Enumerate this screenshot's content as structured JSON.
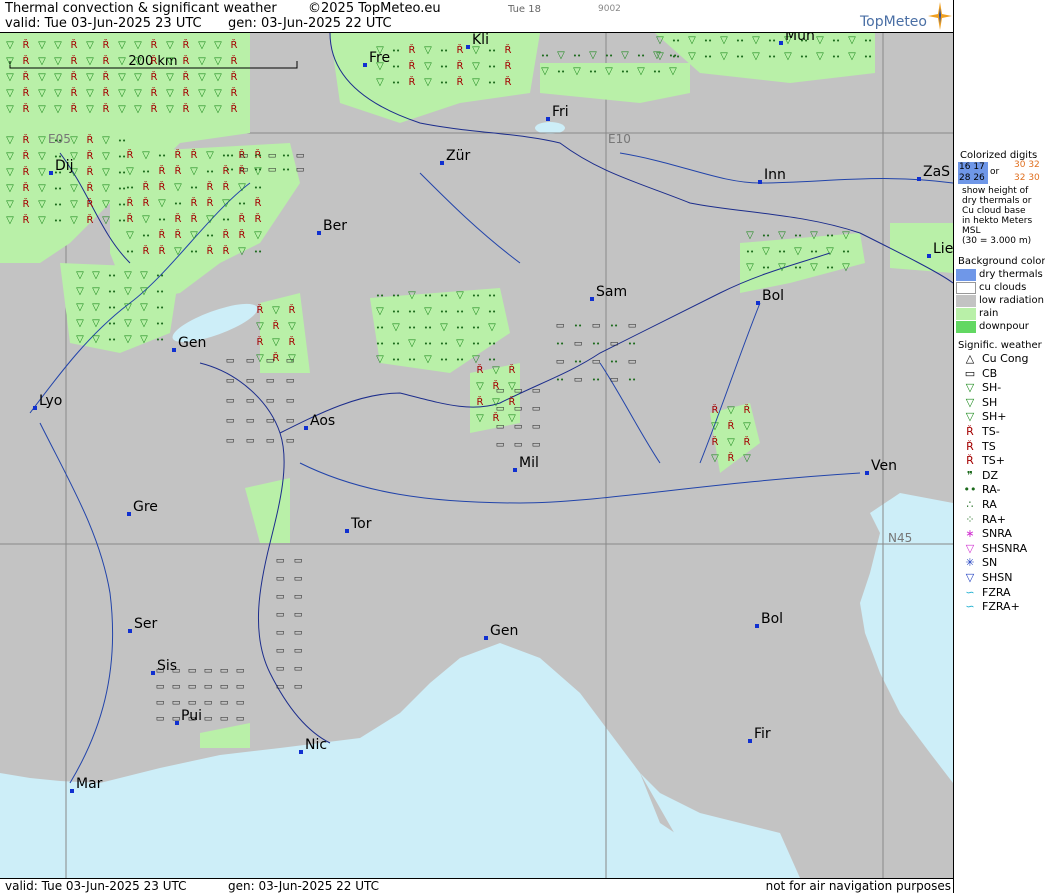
{
  "header": {
    "title": "Thermal convection & significant weather",
    "copyright": "©2025 TopMeteo.eu",
    "valid": "valid:  Tue  03-Jun-2025  23 UTC",
    "gen": "gen: 03-Jun-2025 22 UTC",
    "day_label": "Tue 18",
    "code": "9002",
    "logo": "TopMeteo"
  },
  "footer": {
    "valid": "valid:  Tue  03-Jun-2025  23 UTC",
    "gen": "gen: 03-Jun-2025 22 UTC",
    "note": "not for air navigation purposes"
  },
  "map": {
    "scale_label": "200 km",
    "grid_labels": [
      "E05",
      "E10",
      "N45"
    ],
    "cities": [
      {
        "name": "Kli"
      },
      {
        "name": "Mün"
      },
      {
        "name": "Fre"
      },
      {
        "name": "Fri"
      },
      {
        "name": "Dij"
      },
      {
        "name": "Zür"
      },
      {
        "name": "Inn"
      },
      {
        "name": "ZaS"
      },
      {
        "name": "Ber"
      },
      {
        "name": "Lie"
      },
      {
        "name": "Sam"
      },
      {
        "name": "Bol"
      },
      {
        "name": "Gen"
      },
      {
        "name": "Lyo"
      },
      {
        "name": "Aos"
      },
      {
        "name": "Mil"
      },
      {
        "name": "Ven"
      },
      {
        "name": "Gre"
      },
      {
        "name": "Tor"
      },
      {
        "name": "Ser"
      },
      {
        "name": "Gen"
      },
      {
        "name": "Bol"
      },
      {
        "name": "Sis"
      },
      {
        "name": "Pui"
      },
      {
        "name": "Nic"
      },
      {
        "name": "Fir"
      },
      {
        "name": "Mar"
      }
    ],
    "colors": {
      "land": "#c3c3c3",
      "sea": "#cdeef8",
      "rain": "#b9f0a8",
      "dry": "#6f97e8",
      "border": "#1c2d8c",
      "thunder": "#a40000",
      "shower": "#1c8a1c"
    }
  },
  "legend": {
    "colorized_title": "Colorized digits",
    "digits": [
      "16 17",
      "28 26",
      "or",
      "30 32",
      "32 30"
    ],
    "desc": [
      "show height of",
      "dry thermals or",
      "Cu cloud base",
      "in hekto Meters",
      "MSL",
      "(30 = 3.000 m)"
    ],
    "bg_title": "Background color",
    "bg_items": [
      "dry thermals",
      "cu clouds",
      "low radiation",
      "rain",
      "downpour"
    ],
    "sig_title": "Signific. weather",
    "sig_items": [
      "Cu Cong",
      "CB",
      "SH-",
      "SH",
      "SH+",
      "TS-",
      "TS",
      "TS+",
      "DZ",
      "RA-",
      "RA",
      "RA+",
      "SNRA",
      "SHSNRA",
      "SN",
      "SHSN",
      "FZRA",
      "FZRA+"
    ]
  }
}
